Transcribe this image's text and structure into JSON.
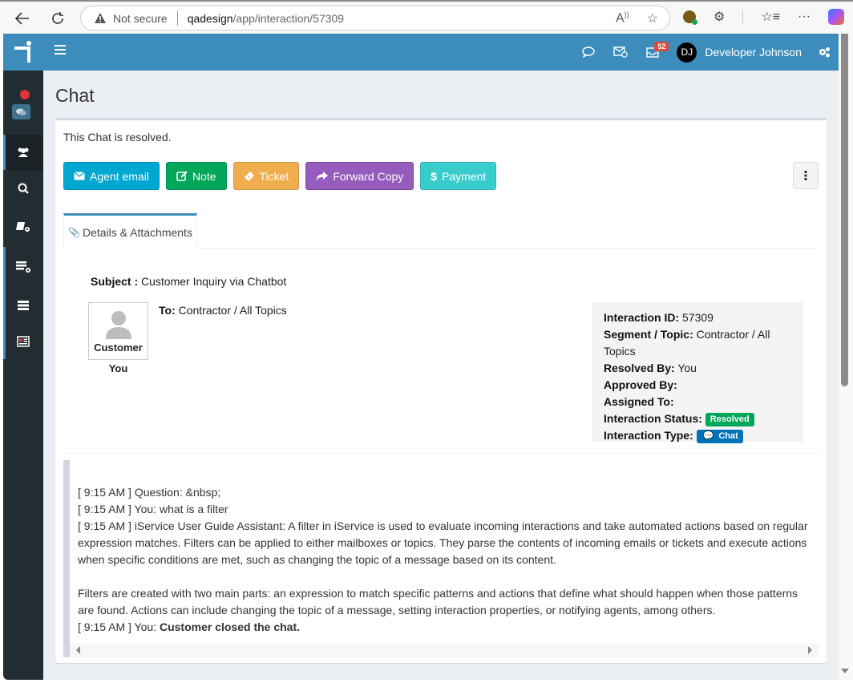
{
  "browser": {
    "security_label": "Not secure",
    "url_host": "qadesign",
    "url_path": "/app/interaction/57309"
  },
  "topbar": {
    "notification_count": "52",
    "user_initials": "DJ",
    "user_name": "Developer Johnson"
  },
  "page": {
    "title": "Chat",
    "status_message": "This Chat is resolved."
  },
  "actions": {
    "agent_email": "Agent email",
    "note": "Note",
    "ticket": "Ticket",
    "forward_copy": "Forward Copy",
    "payment": "Payment"
  },
  "tabs": {
    "details": "Details & Attachments"
  },
  "details": {
    "subject_label": "Subject :",
    "subject_value": "Customer Inquiry via Chatbot",
    "customer_label": "Customer",
    "customer_name": "You",
    "to_label": "To:",
    "to_value": "Contractor / All Topics"
  },
  "info": {
    "interaction_id_label": "Interaction ID:",
    "interaction_id": "57309",
    "segment_label": "Segment / Topic:",
    "segment": "Contractor / All Topics",
    "resolved_by_label": "Resolved By:",
    "resolved_by": "You",
    "approved_by_label": "Approved By:",
    "approved_by": "",
    "assigned_to_label": "Assigned To:",
    "assigned_to": "",
    "status_label": "Interaction Status:",
    "status": "Resolved",
    "status_color": "#00a65a",
    "type_label": "Interaction Type:",
    "type": "Chat",
    "type_color": "#0073b7"
  },
  "transcript": {
    "lines": [
      "[ 9:15 AM ] Question: &nbsp;",
      "[ 9:15 AM ] You: what is a filter",
      "[ 9:15 AM ] iService User Guide Assistant: A filter in iService is used to evaluate incoming interactions and take automated actions based on regular expression matches. Filters can be applied to either mailboxes or topics. They parse the contents of incoming emails or tickets and execute actions when specific conditions are met, such as changing the topic of a message based on its content.",
      "Filters are created with two main parts: an expression to match specific patterns and actions that define what should happen when those patterns are found. Actions can include changing the topic of a message, setting interaction properties, or notifying agents, among others."
    ],
    "last_prefix": "[ 9:15 AM ] You: ",
    "last_bold": "Customer closed the chat."
  },
  "colors": {
    "brand": "#3c8dbc",
    "sidebar": "#222d32"
  }
}
